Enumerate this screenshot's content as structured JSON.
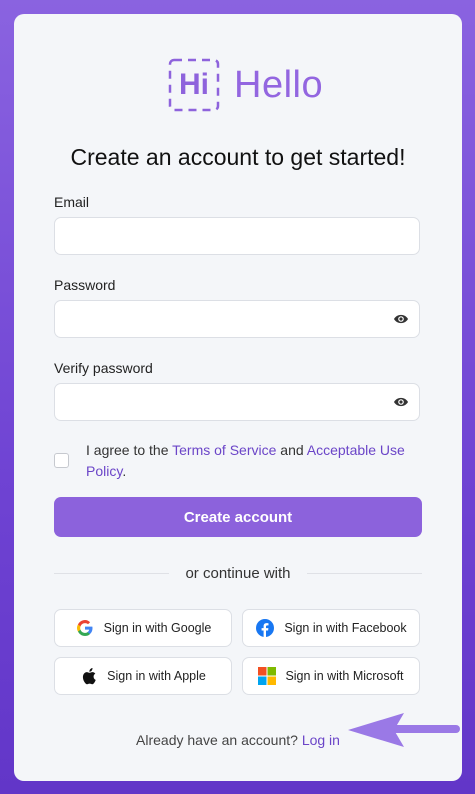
{
  "brand": {
    "mark": "Hi",
    "name": "Hello"
  },
  "title": "Create an account to get started!",
  "form": {
    "email_label": "Email",
    "email_value": "",
    "password_label": "Password",
    "password_value": "",
    "verify_label": "Verify password",
    "verify_value": "",
    "agree_prefix": "I agree to the ",
    "terms_link": "Terms of Service",
    "agree_middle": " and ",
    "aup_link": "Acceptable Use Policy",
    "agree_suffix": ".",
    "submit": "Create account"
  },
  "divider": "or continue with",
  "social": {
    "google": "Sign in with Google",
    "facebook": "Sign in with Facebook",
    "apple": "Sign in with Apple",
    "microsoft": "Sign in with Microsoft"
  },
  "footer": {
    "text": "Already have an account?",
    "login": "Log in"
  },
  "colors": {
    "accent": "#8c62dc",
    "link": "#6b45c8",
    "background": "#7a4fda"
  },
  "icons": [
    "eye-icon",
    "google-icon",
    "facebook-icon",
    "apple-icon",
    "microsoft-icon",
    "arrow-icon"
  ]
}
